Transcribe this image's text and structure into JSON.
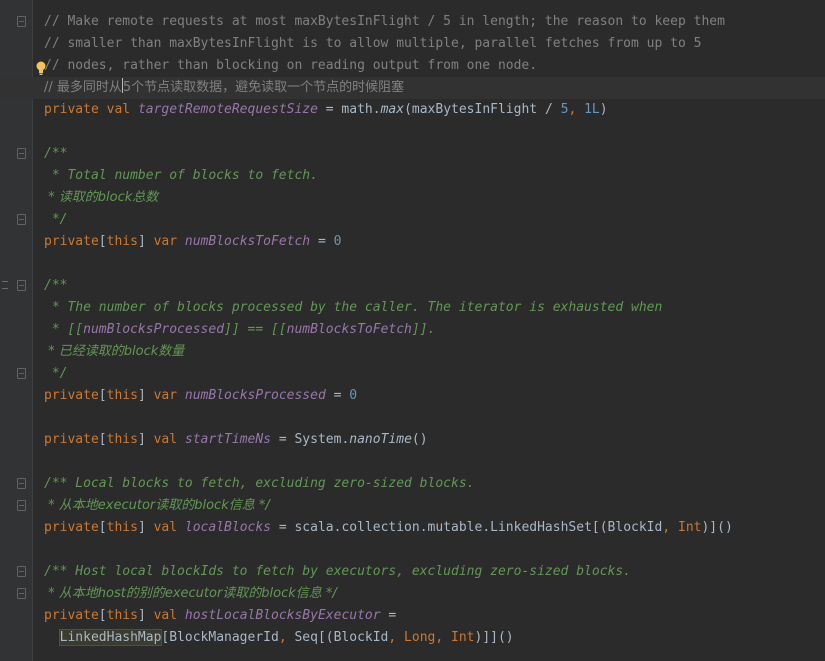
{
  "editor": {
    "comment_lines": [
      "// Make remote requests at most maxBytesInFlight / 5 in length; the reason to keep them",
      "// smaller than maxBytesInFlight is to allow multiple, parallel fetches from up to 5",
      "// nodes, rather than blocking on reading output from one node."
    ],
    "cn_comment_a": "// 最多同时从",
    "cn_comment_b": "5个节点读取数据，避免读取一个节点的时候阻塞",
    "l5": {
      "kw1": "private",
      "kw2": "val",
      "name": "targetRemoteRequestSize",
      "eq": " = math.",
      "fn": "max",
      "rest": "(maxBytesInFlight / ",
      "n1": "5",
      "comma": ", ",
      "n2": "1L",
      "close": ")"
    },
    "doc1": [
      "/**",
      " * Total number of blocks to fetch.",
      " * 读取的block总数",
      " */"
    ],
    "l11": {
      "kw": "private",
      "br1": "[",
      "this": "this",
      "br2": "]",
      "var": "var",
      "name": "numBlocksToFetch",
      "eq": " = ",
      "val": "0"
    },
    "doc2": [
      "/**",
      " * The number of blocks processed by the caller. The iterator is exhausted when",
      " * ",
      "[[",
      "numBlocksProcessed",
      "]] == [[",
      "numBlocksToFetch",
      "]].",
      " * 已经读取的block数量",
      " */"
    ],
    "l18": {
      "kw": "private",
      "br1": "[",
      "this": "this",
      "br2": "]",
      "var": "var",
      "name": "numBlocksProcessed",
      "eq": " = ",
      "val": "0"
    },
    "l20": {
      "kw": "private",
      "br1": "[",
      "this": "this",
      "br2": "]",
      "val": "val",
      "name": "startTimeNs",
      "eq": " = System.",
      "fn": "nanoTime",
      "close": "()"
    },
    "doc3": [
      "/** Local blocks to fetch, excluding zero-sized blocks.",
      " * 从本地executor读取的block信息 */"
    ],
    "l24": {
      "kw": "private",
      "br1": "[",
      "this": "this",
      "br2": "]",
      "val": "val",
      "name": "localBlocks",
      "eq": " = scala.collection.mutable.LinkedHashSet[(BlockId",
      "comma": ", ",
      "typ": "Int",
      "close": ")]()"
    },
    "doc4": [
      "/** Host local blockIds to fetch by executors, excluding zero-sized blocks.",
      " * 从本地host的别的executor读取的block信息 */"
    ],
    "l28": {
      "kw": "private",
      "br1": "[",
      "this": "this",
      "br2": "]",
      "val": "val",
      "name": "hostLocalBlocksByExecutor",
      "eq": " ="
    },
    "l29": {
      "indent": "  ",
      "hl": "LinkedHashMap",
      "rest": "[BlockManagerId",
      "comma1": ", ",
      "seq": "Seq[(BlockId",
      "comma2": ", ",
      "t1": "Long",
      "comma3": ", ",
      "t2": "Int",
      "close": ")]]()"
    }
  }
}
